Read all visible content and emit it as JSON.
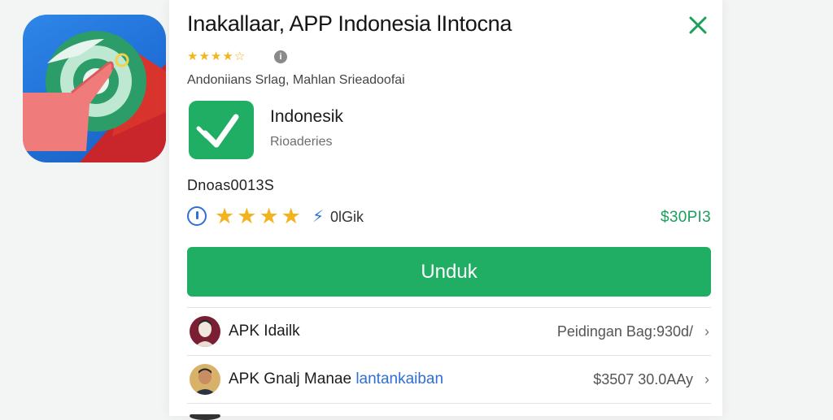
{
  "dialog": {
    "title": "Inakallaar, APP Indonesia lIntocna",
    "subtitle": "Andoniians Srlag, Mahlan Srieadoofai",
    "close_icon": "close-icon"
  },
  "app": {
    "name": "Indonesik",
    "sub": "Rioaderies",
    "section_title": "Dnoas0013S",
    "rating_count": "0lGik",
    "price": "$30PI3",
    "stars": 4,
    "download_label": "Unduk"
  },
  "colors": {
    "accent_green": "#1fae63",
    "price_green": "#1aa05a",
    "star_yellow": "#f4b21c",
    "link_blue": "#2f6fd6"
  },
  "list": [
    {
      "label": "APK Idailk",
      "label_blue": "",
      "right": "Peidingan Bag:930d/"
    },
    {
      "label": "APK Gnalj Manae",
      "label_blue": "lantankaiban",
      "right": "$3507 30.0AAy"
    }
  ]
}
